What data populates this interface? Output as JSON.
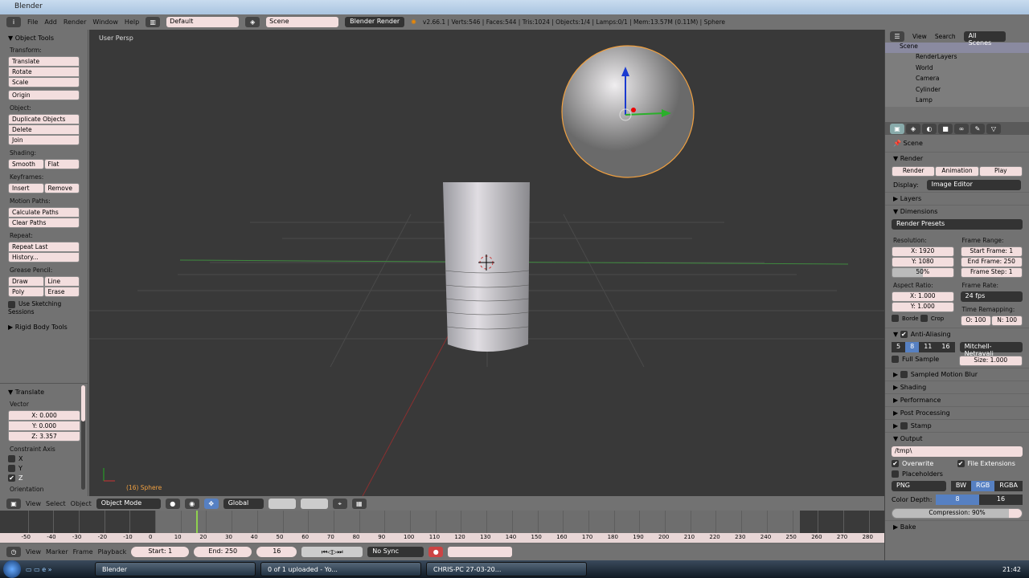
{
  "window": {
    "title": "Blender"
  },
  "topbar": {
    "menus": [
      "File",
      "Add",
      "Render",
      "Window",
      "Help"
    ],
    "layout": "Default",
    "scene": "Scene",
    "engine": "Blender Render",
    "stats": "v2.66.1 | Verts:546 | Faces:544 | Tris:1024 | Objects:1/4 | Lamps:0/1 | Mem:13.57M (0.11M) | Sphere"
  },
  "toolshelf": {
    "title": "Object Tools",
    "transform_label": "Transform:",
    "translate": "Translate",
    "rotate": "Rotate",
    "scale": "Scale",
    "origin": "Origin",
    "object_label": "Object:",
    "duplicate": "Duplicate Objects",
    "delete": "Delete",
    "join": "Join",
    "shading_label": "Shading:",
    "smooth": "Smooth",
    "flat": "Flat",
    "keyframes_label": "Keyframes:",
    "insert": "Insert",
    "remove": "Remove",
    "motion_label": "Motion Paths:",
    "calc_paths": "Calculate Paths",
    "clear_paths": "Clear Paths",
    "repeat_label": "Repeat:",
    "repeat_last": "Repeat Last",
    "history": "History...",
    "grease_label": "Grease Pencil:",
    "draw": "Draw",
    "line": "Line",
    "poly": "Poly",
    "erase": "Erase",
    "sketching": "Use Sketching Sessions",
    "rigid": "Rigid Body Tools"
  },
  "operator": {
    "title": "Translate",
    "vector_label": "Vector",
    "x": "X: 0.000",
    "y": "Y: 0.000",
    "z": "Z: 3.357",
    "constraint_label": "Constraint Axis",
    "axes": [
      "X",
      "Y",
      "Z"
    ],
    "orientation": "Orientation"
  },
  "viewport": {
    "view_label": "User Persp",
    "object_label": "(16) Sphere"
  },
  "header3d": {
    "view": "View",
    "select": "Select",
    "object": "Object",
    "mode": "Object Mode",
    "orientation": "Global"
  },
  "timeline": {
    "ticks": [
      -50,
      -40,
      -30,
      -20,
      -10,
      0,
      10,
      20,
      30,
      40,
      50,
      60,
      70,
      80,
      90,
      100,
      110,
      120,
      130,
      140,
      150,
      160,
      170,
      180,
      190,
      200,
      210,
      220,
      230,
      240,
      250,
      260,
      270,
      280
    ],
    "current_frame": 16,
    "start": 1,
    "end": 250
  },
  "tlheader": {
    "view": "View",
    "marker": "Marker",
    "frame": "Frame",
    "playback": "Playback",
    "start": "Start: 1",
    "end": "End: 250",
    "current": "16",
    "sync": "No Sync"
  },
  "outliner": {
    "view": "View",
    "search": "Search",
    "filter": "All Scenes",
    "items": [
      "Scene",
      "RenderLayers",
      "World",
      "Camera",
      "Cylinder",
      "Lamp"
    ]
  },
  "properties": {
    "scene": "Scene",
    "render_section": "Render",
    "render_btn": "Render",
    "animation_btn": "Animation",
    "play_btn": "Play",
    "display_label": "Display:",
    "display": "Image Editor",
    "layers": "Layers",
    "dimensions": "Dimensions",
    "presets": "Render Presets",
    "resolution_label": "Resolution:",
    "res_x": "X: 1920",
    "res_y": "Y: 1080",
    "res_pct": "50%",
    "res_pct_value": 50,
    "frame_range_label": "Frame Range:",
    "start_frame": "Start Frame: 1",
    "end_frame": "End Frame: 250",
    "frame_step": "Frame Step: 1",
    "aspect_label": "Aspect Ratio:",
    "asp_x": "X: 1.000",
    "asp_y": "Y: 1.000",
    "frame_rate_label": "Frame Rate:",
    "fps": "24 fps",
    "border": "Borde",
    "crop": "Crop",
    "time_remap_label": "Time Remapping:",
    "old": "O: 100",
    "new": "N: 100",
    "aa": "Anti-Aliasing",
    "aa_samples": [
      "5",
      "8",
      "11",
      "16"
    ],
    "aa_filter": "Mitchell-Netravali",
    "full_sample": "Full Sample",
    "size": "Size: 1.000",
    "motion_blur": "Sampled Motion Blur",
    "shading": "Shading",
    "performance": "Performance",
    "post": "Post Processing",
    "stamp": "Stamp",
    "output": "Output",
    "path": "/tmp\\",
    "overwrite": "Overwrite",
    "file_ext": "File Extensions",
    "placeholders": "Placeholders",
    "format": "PNG",
    "bw": "BW",
    "rgb": "RGB",
    "rgba": "RGBA",
    "color_depth_label": "Color Depth:",
    "depth8": "8",
    "depth16": "16",
    "compression": "Compression: 90%",
    "compression_value": 90,
    "bake": "Bake"
  },
  "taskbar": {
    "tasks": [
      "Blender",
      "0 of 1 uploaded - Yo...",
      "CHRIS-PC 27-03-20..."
    ],
    "clock": "21:42"
  }
}
